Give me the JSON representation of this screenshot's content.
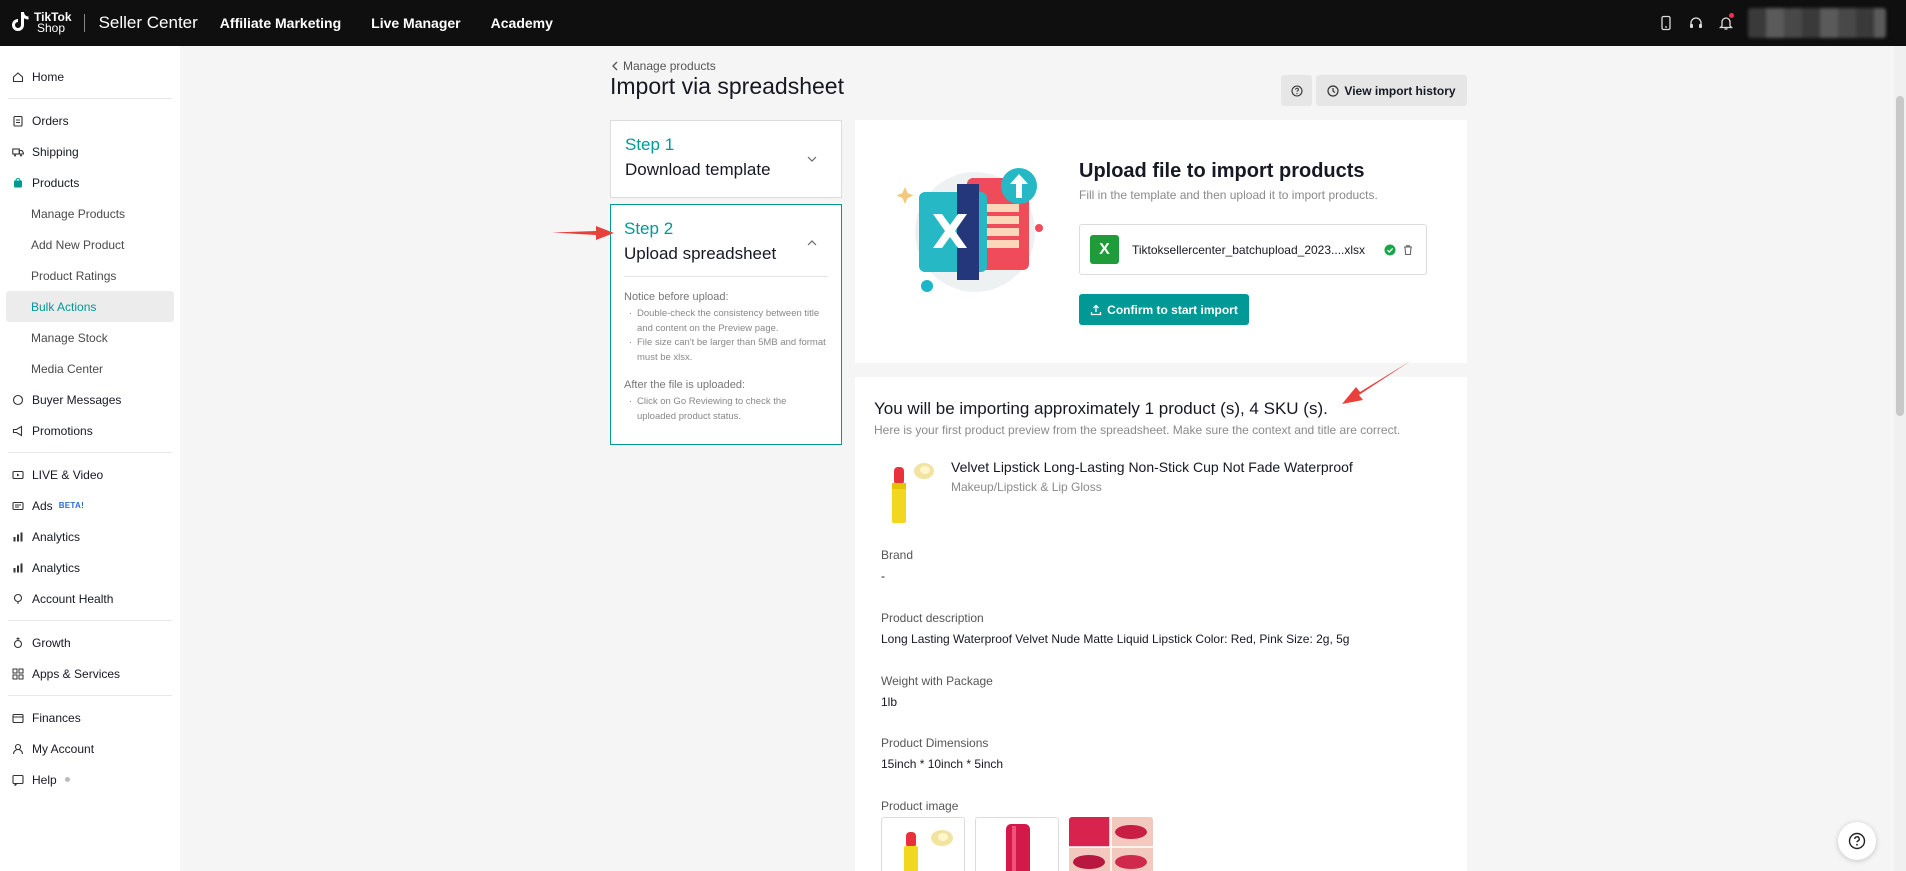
{
  "topbar": {
    "logo_line1": "TikTok",
    "logo_line2": "Shop",
    "brand": "Seller Center",
    "nav": [
      "Affiliate Marketing",
      "Live Manager",
      "Academy"
    ]
  },
  "sidebar": {
    "items": [
      {
        "label": "Home",
        "icon": "home-icon"
      },
      {
        "label": "Orders",
        "icon": "clipboard-icon"
      },
      {
        "label": "Shipping",
        "icon": "truck-icon"
      },
      {
        "label": "Products",
        "icon": "bag-icon"
      },
      {
        "label": "Manage Products"
      },
      {
        "label": "Add New Product"
      },
      {
        "label": "Product Ratings"
      },
      {
        "label": "Bulk Actions"
      },
      {
        "label": "Manage Stock"
      },
      {
        "label": "Media Center"
      },
      {
        "label": "Buyer Messages",
        "icon": "chat-icon"
      },
      {
        "label": "Promotions",
        "icon": "megaphone-icon"
      },
      {
        "label": "LIVE & Video",
        "icon": "live-icon"
      },
      {
        "label": "Ads",
        "icon": "ads-icon",
        "badge": "BETA!"
      },
      {
        "label": "Analytics",
        "icon": "chart-icon"
      },
      {
        "label": "Analytics",
        "icon": "chart-icon"
      },
      {
        "label": "Account Health",
        "icon": "health-icon"
      },
      {
        "label": "Growth",
        "icon": "growth-icon"
      },
      {
        "label": "Apps & Services",
        "icon": "apps-icon"
      },
      {
        "label": "Finances",
        "icon": "wallet-icon"
      },
      {
        "label": "My Account",
        "icon": "user-icon"
      },
      {
        "label": "Help",
        "icon": "help-icon"
      }
    ]
  },
  "header": {
    "back_label": "Manage products",
    "title": "Import via spreadsheet",
    "history_label": "View import history"
  },
  "steps": {
    "step1_label": "Step 1",
    "step1_title": "Download template",
    "step2_label": "Step 2",
    "step2_title": "Upload spreadsheet",
    "notice_before": "Notice before upload:",
    "notice_items": [
      "Double-check the consistency between title and content on the Preview page.",
      "File size can't be larger than 5MB and format must be xlsx."
    ],
    "notice_after": "After the file is uploaded:",
    "after_items": [
      "Click on Go Reviewing to check the uploaded product status."
    ]
  },
  "upload": {
    "title": "Upload file to import products",
    "subtitle": "Fill in the template and then upload it to import products.",
    "file_icon_letter": "X",
    "file_name": "Tiktoksellercenter_batchupload_2023....xlsx",
    "confirm_label": "Confirm to start import"
  },
  "preview": {
    "title": "You will be importing approximately 1 product (s), 4 SKU (s).",
    "subtitle": "Here is your first product preview from the spreadsheet. Make sure the context and title are correct.",
    "product_name": "Velvet Lipstick Long-Lasting Non-Stick Cup Not Fade Waterproof",
    "product_category": "Makeup/Lipstick & Lip Gloss",
    "fields": [
      {
        "label": "Brand",
        "value": "-"
      },
      {
        "label": "Product description",
        "value": "Long Lasting Waterproof Velvet Nude Matte Liquid Lipstick Color: Red, Pink Size: 2g, 5g"
      },
      {
        "label": "Weight with Package",
        "value": "1lb"
      },
      {
        "label": "Product Dimensions",
        "value": "15inch * 10inch * 5inch"
      },
      {
        "label": "Product image",
        "value": ""
      }
    ]
  },
  "colors": {
    "accent": "#009995",
    "topbar": "#0f0f0f",
    "annotation_arrow": "#e8403a"
  }
}
